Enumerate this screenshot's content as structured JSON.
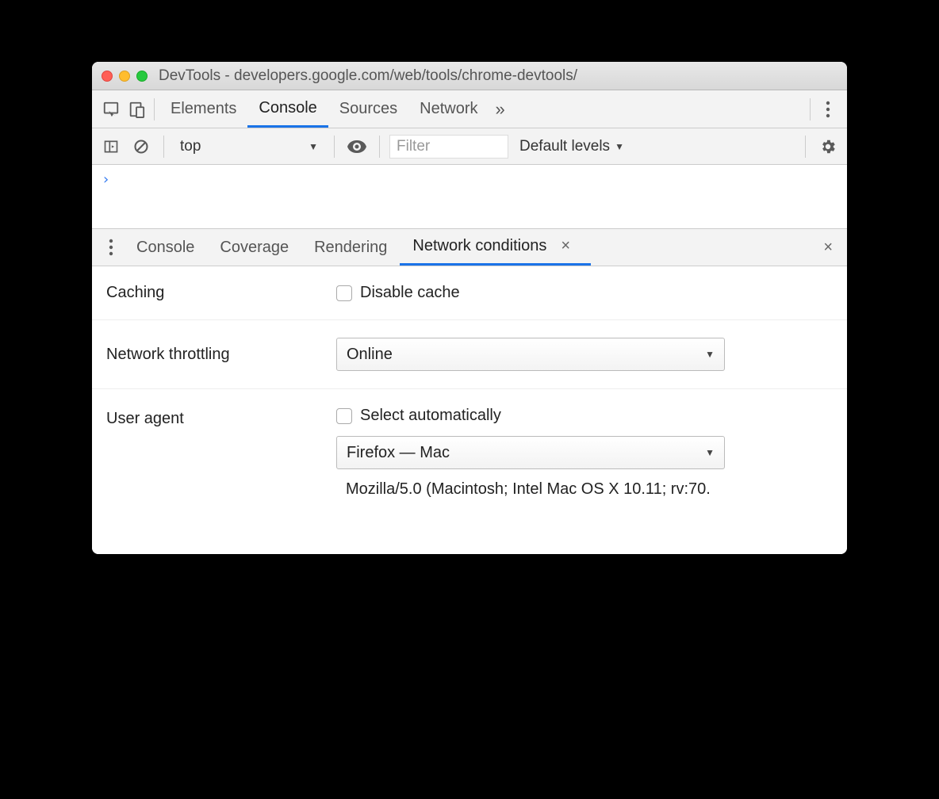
{
  "window": {
    "title": "DevTools - developers.google.com/web/tools/chrome-devtools/"
  },
  "mainTabs": {
    "items": [
      {
        "label": "Elements"
      },
      {
        "label": "Console"
      },
      {
        "label": "Sources"
      },
      {
        "label": "Network"
      }
    ],
    "activeIndex": 1
  },
  "consoleToolbar": {
    "context": "top",
    "filterPlaceholder": "Filter",
    "levels": "Default levels"
  },
  "consolePrompt": "›",
  "drawer": {
    "tabs": [
      {
        "label": "Console"
      },
      {
        "label": "Coverage"
      },
      {
        "label": "Rendering"
      },
      {
        "label": "Network conditions"
      }
    ],
    "activeIndex": 3
  },
  "networkConditions": {
    "cachingLabel": "Caching",
    "disableCacheLabel": "Disable cache",
    "throttlingLabel": "Network throttling",
    "throttlingValue": "Online",
    "userAgentLabel": "User agent",
    "selectAutoLabel": "Select automatically",
    "userAgentValue": "Firefox — Mac",
    "userAgentString": "Mozilla/5.0 (Macintosh; Intel Mac OS X 10.11; rv:70."
  }
}
